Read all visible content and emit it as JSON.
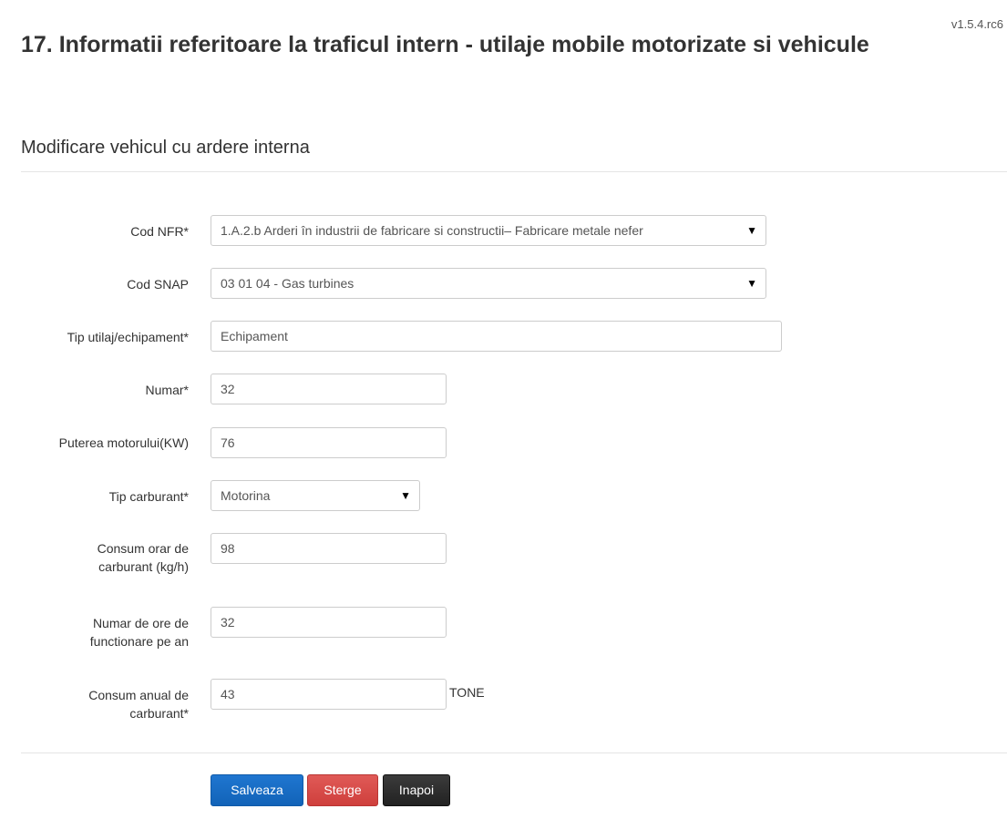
{
  "version": "v1.5.4.rc6",
  "page_title": "17. Informatii referitoare la traficul intern - utilaje mobile motorizate si vehicule",
  "subtitle": "Modificare vehicul cu ardere interna",
  "form": {
    "cod_nfr": {
      "label": "Cod NFR*",
      "value": "1.A.2.b Arderi în industrii de fabricare si constructii– Fabricare metale nefer"
    },
    "cod_snap": {
      "label": "Cod SNAP",
      "value": "03 01 04 - Gas turbines"
    },
    "tip_utilaj": {
      "label": "Tip utilaj/echipament*",
      "value": "Echipament"
    },
    "numar": {
      "label": "Numar*",
      "value": "32"
    },
    "puterea": {
      "label": "Puterea motorului(KW)",
      "value": "76"
    },
    "tip_carburant": {
      "label": "Tip carburant*",
      "value": "Motorina"
    },
    "consum_orar": {
      "label_line1": "Consum orar de",
      "label_line2": "carburant (kg/h)",
      "value": "98"
    },
    "numar_ore": {
      "label_line1": "Numar de ore de",
      "label_line2": "functionare pe an",
      "value": "32"
    },
    "consum_anual": {
      "label_line1": "Consum anual de",
      "label_line2": "carburant*",
      "value": "43",
      "unit": "TONE"
    }
  },
  "buttons": {
    "save": "Salveaza",
    "delete": "Sterge",
    "back": "Inapoi"
  },
  "icons": {
    "dropdown": "▼"
  },
  "colors": {
    "primary": "#1a6ec6",
    "danger": "#d9534f",
    "dark": "#2b2b2b"
  }
}
